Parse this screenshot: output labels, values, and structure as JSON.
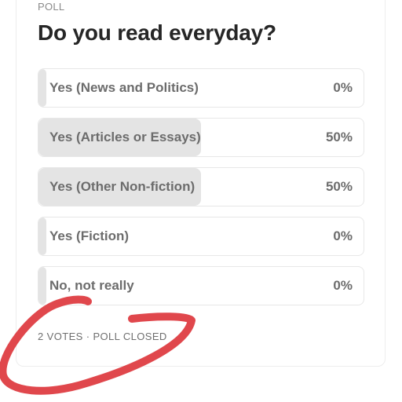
{
  "poll": {
    "kicker": "POLL",
    "question": "Do you read everyday?",
    "options": [
      {
        "label": "Yes (News and Politics)",
        "percent_text": "0%",
        "share": 0.0
      },
      {
        "label": "Yes (Articles or Essays)",
        "percent_text": "50%",
        "share": 0.5
      },
      {
        "label": "Yes (Other Non-fiction)",
        "percent_text": "50%",
        "share": 0.5
      },
      {
        "label": "Yes (Fiction)",
        "percent_text": "0%",
        "share": 0.0
      },
      {
        "label": "No, not really",
        "percent_text": "0%",
        "share": 0.0
      }
    ],
    "footer": "2 VOTES · POLL CLOSED"
  },
  "colors": {
    "bar_fill": "#e4e4e4",
    "annotation_red": "#e0474c"
  }
}
